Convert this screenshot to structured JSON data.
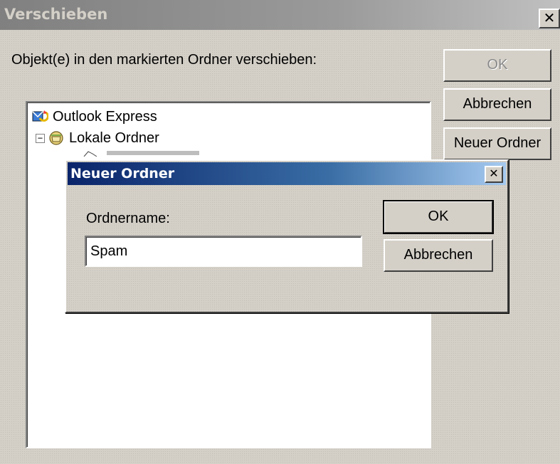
{
  "outer_dialog": {
    "title": "Verschieben",
    "close_glyph": "✕",
    "prompt": "Objekt(e) in den markierten Ordner verschieben:",
    "buttons": {
      "ok": "OK",
      "cancel": "Abbrechen",
      "new_folder": "Neuer Ordner"
    },
    "tree": {
      "root": {
        "label": "Outlook Express",
        "icon": "outlook-express-icon"
      },
      "child": {
        "label": "Lokale Ordner",
        "icon": "local-folders-icon",
        "expander": "−"
      }
    }
  },
  "new_folder_dialog": {
    "title": "Neuer Ordner",
    "close_glyph": "✕",
    "folder_name_label": "Ordnername:",
    "folder_name_value": "Spam",
    "buttons": {
      "ok": "OK",
      "cancel": "Abbrechen"
    }
  },
  "colors": {
    "dialog_face": "#d4d0c8",
    "active_title_start": "#0a246a",
    "active_title_end": "#a6caf0",
    "inactive_title": "#808080"
  }
}
